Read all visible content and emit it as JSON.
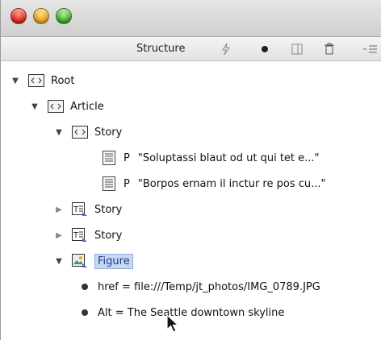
{
  "toolbar": {
    "title": "Structure"
  },
  "tree": {
    "root_label": "Root",
    "article_label": "Article",
    "story_label": "Story",
    "p1_tag": "P",
    "p1_text": "\"Soluptassi blaut od ut qui tet e...\"",
    "p2_tag": "P",
    "p2_text": "\"Borpos ernam il inctur re pos cu...\"",
    "story2_label": "Story",
    "story3_label": "Story",
    "figure_label": "Figure",
    "attr1": "href = file:///Temp/jt_photos/IMG_0789.JPG",
    "attr2": "Alt = The Seattle downtown skyline"
  },
  "icons": {
    "element": "element-tag-icon",
    "text_frame": "text-frame-icon",
    "figure": "figure-icon",
    "paragraph": "paragraph-icon"
  },
  "colors": {
    "selection_bg": "#c9d8f2",
    "selection_text": "#1a3a8a"
  }
}
